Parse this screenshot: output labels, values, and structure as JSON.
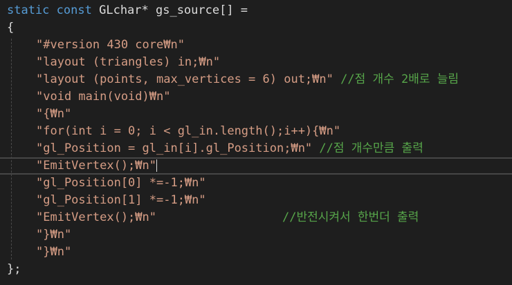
{
  "code": {
    "line1": {
      "kw1": "static",
      "kw2": "const",
      "rest": "GLchar* gs_source[] ="
    },
    "line2": "{",
    "line3": "\"#version 430 core₩n\"",
    "line4": "\"layout (triangles) in;₩n\"",
    "line5": {
      "str": "\"layout (points, max_vertices = 6) out;₩n\"",
      "comment": "//점 개수 2배로 늘림"
    },
    "line6": "\"void main(void)₩n\"",
    "line7": "\"{₩n\"",
    "line8": "\"for(int i = 0; i < gl_in.length();i++){₩n\"",
    "line9": {
      "str": "\"gl_Position = gl_in[i].gl_Position;₩n\"",
      "comment": "//점 개수만큼 출력"
    },
    "line10": "\"EmitVertex();₩n\"",
    "line11": "\"gl_Position[0] *=-1;₩n\"",
    "line12": "\"gl_Position[1] *=-1;₩n\"",
    "line13": {
      "str": "\"EmitVertex();₩n\"",
      "comment": "//반전시켜서 한번더 출력"
    },
    "line14": "\"}₩n\"",
    "line15": "\"}₩n\"",
    "line16": "};"
  }
}
